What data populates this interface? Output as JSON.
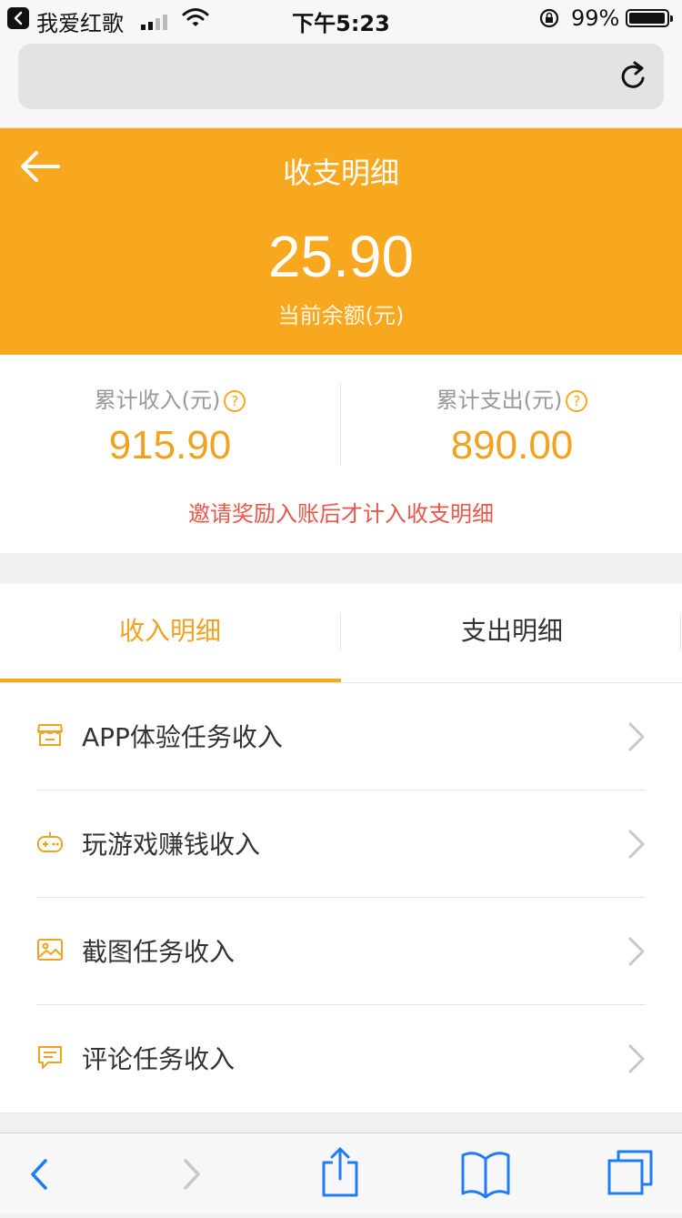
{
  "status_bar": {
    "app_name": "我爱红歌",
    "time": "下午5:23",
    "battery": "99%"
  },
  "header": {
    "title": "收支明细",
    "balance": "25.90",
    "balance_label": "当前余额(元)"
  },
  "summary": {
    "income_label": "累计收入(元)",
    "income_value": "915.90",
    "expense_label": "累计支出(元)",
    "expense_value": "890.00",
    "help_symbol": "?",
    "notice": "邀请奖励入账后才计入收支明细"
  },
  "tabs": [
    {
      "label": "收入明细",
      "active": true
    },
    {
      "label": "支出明细",
      "active": false
    }
  ],
  "items": [
    {
      "label": "APP体验任务收入",
      "icon": "store-icon"
    },
    {
      "label": "玩游戏赚钱收入",
      "icon": "gamepad-icon"
    },
    {
      "label": "截图任务收入",
      "icon": "image-icon"
    },
    {
      "label": "评论任务收入",
      "icon": "comment-icon"
    }
  ],
  "colors": {
    "accent": "#f7a81e",
    "amount": "#f2a221",
    "notice": "#e9574a",
    "ios_blue": "#1f7cf4"
  }
}
